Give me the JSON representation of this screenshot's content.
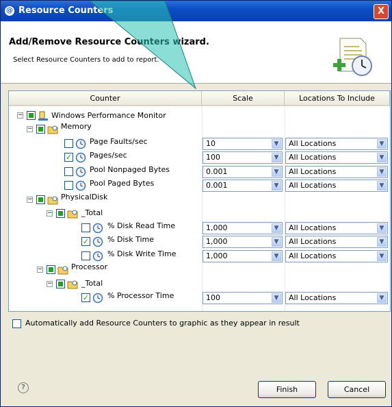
{
  "window": {
    "title": "Resource Counters",
    "close_label": "X"
  },
  "wizard": {
    "title": "Add/Remove Resource Counters wizard.",
    "description": "Select Resource Counters to add to report."
  },
  "table": {
    "columns": [
      "Counter",
      "Scale",
      "Locations To Include"
    ],
    "rows": [
      {
        "label": "Windows Performance Monitor"
      },
      {
        "label": "Memory"
      },
      {
        "label": "Page Faults/sec",
        "scale": "10",
        "location": "All Locations"
      },
      {
        "label": "Pages/sec",
        "scale": "100",
        "location": "All Locations"
      },
      {
        "label": "Pool Nonpaged Bytes",
        "scale": "0.001",
        "location": "All Locations"
      },
      {
        "label": "Pool Paged Bytes",
        "scale": "0.001",
        "location": "All Locations"
      },
      {
        "label": "PhysicalDisk"
      },
      {
        "label": "_Total"
      },
      {
        "label": "% Disk Read Time",
        "scale": "1,000",
        "location": "All Locations"
      },
      {
        "label": "% Disk Time",
        "scale": "1,000",
        "location": "All Locations"
      },
      {
        "label": "% Disk Write Time",
        "scale": "1,000",
        "location": "All Locations"
      },
      {
        "label": "Processor"
      },
      {
        "label": "_Total"
      },
      {
        "label": "% Processor Time",
        "scale": "100",
        "location": "All Locations"
      }
    ]
  },
  "auto_add_label": "Automatically add Resource Counters to graphic as they appear in result",
  "buttons": {
    "help": "?",
    "finish": "Finish",
    "cancel": "Cancel"
  },
  "colors": {
    "accent": "#0a4fc4",
    "check": "#21a121"
  }
}
